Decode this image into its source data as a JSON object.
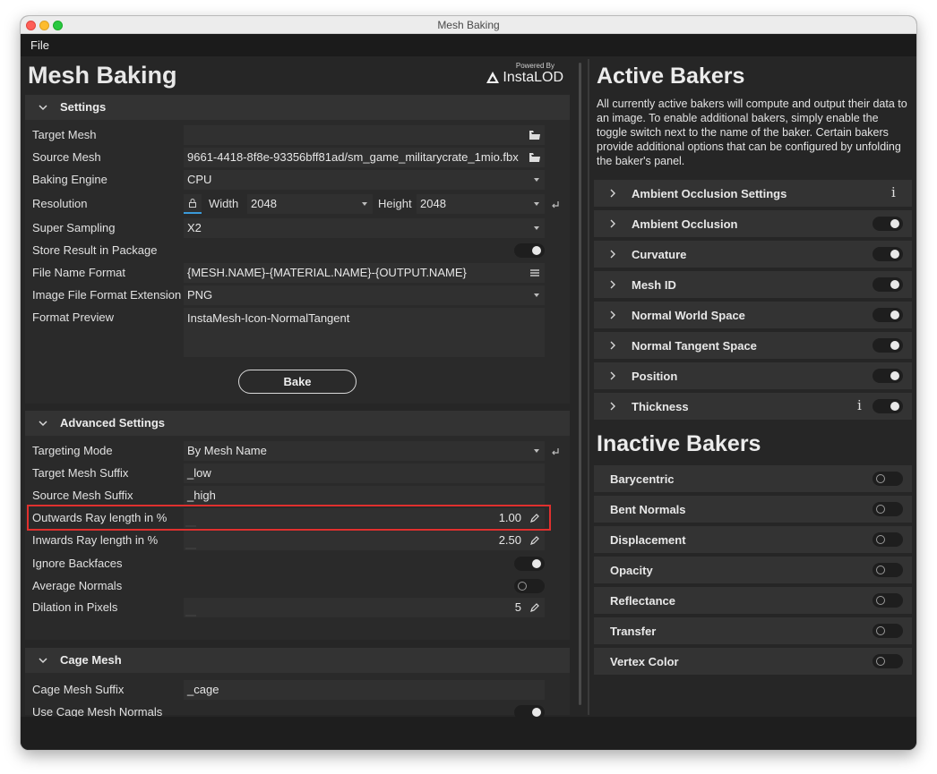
{
  "window": {
    "title": "Mesh Baking"
  },
  "menu": {
    "file": "File"
  },
  "app": {
    "title": "Mesh Baking",
    "powered_by": "Powered By",
    "brand": "InstaLOD"
  },
  "settings": {
    "header": "Settings",
    "target_mesh": {
      "label": "Target Mesh",
      "value": ""
    },
    "source_mesh": {
      "label": "Source Mesh",
      "value": "9661-4418-8f8e-93356bff81ad/sm_game_militarycrate_1mio.fbx"
    },
    "baking_engine": {
      "label": "Baking Engine",
      "value": "CPU"
    },
    "resolution": {
      "label": "Resolution",
      "width_label": "Width",
      "width": "2048",
      "height_label": "Height",
      "height": "2048"
    },
    "super_sampling": {
      "label": "Super Sampling",
      "value": "X2"
    },
    "store_result": {
      "label": "Store Result in Package",
      "on": true
    },
    "file_name_format": {
      "label": "File Name Format",
      "value": "{MESH.NAME}-{MATERIAL.NAME}-{OUTPUT.NAME}"
    },
    "image_ext": {
      "label": "Image File Format Extension",
      "value": "PNG"
    },
    "format_preview": {
      "label": "Format Preview",
      "value": "InstaMesh-Icon-NormalTangent"
    },
    "bake_button": "Bake"
  },
  "advanced": {
    "header": "Advanced Settings",
    "targeting_mode": {
      "label": "Targeting Mode",
      "value": "By Mesh Name"
    },
    "target_suffix": {
      "label": "Target Mesh Suffix",
      "value": "_low"
    },
    "source_suffix": {
      "label": "Source Mesh Suffix",
      "value": "_high"
    },
    "outwards_ray": {
      "label": "Outwards Ray length in %",
      "value": "1.00"
    },
    "inwards_ray": {
      "label": "Inwards Ray length in %",
      "value": "2.50"
    },
    "ignore_backfaces": {
      "label": "Ignore Backfaces",
      "on": true
    },
    "average_normals": {
      "label": "Average Normals",
      "on": false
    },
    "dilation": {
      "label": "Dilation in Pixels",
      "value": "5"
    }
  },
  "cage": {
    "header": "Cage Mesh",
    "suffix": {
      "label": "Cage Mesh Suffix",
      "value": "_cage"
    },
    "use_normals": {
      "label": "Use Cage Mesh Normals",
      "on": true
    }
  },
  "active": {
    "title": "Active Bakers",
    "description": "All currently active bakers will compute and output their data to an image. To enable additional bakers, simply enable the toggle switch next to the name of the baker. Certain bakers provide additional options that can be configured by unfolding the baker's panel.",
    "items": [
      {
        "name": "Ambient Occlusion Settings",
        "info": "i"
      },
      {
        "name": "Ambient Occlusion"
      },
      {
        "name": "Curvature"
      },
      {
        "name": "Mesh ID"
      },
      {
        "name": "Normal World Space"
      },
      {
        "name": "Normal Tangent Space"
      },
      {
        "name": "Position"
      },
      {
        "name": "Thickness",
        "info": "i"
      }
    ]
  },
  "inactive": {
    "title": "Inactive Bakers",
    "items": [
      {
        "name": "Barycentric"
      },
      {
        "name": "Bent Normals"
      },
      {
        "name": "Displacement"
      },
      {
        "name": "Opacity"
      },
      {
        "name": "Reflectance"
      },
      {
        "name": "Transfer"
      },
      {
        "name": "Vertex Color"
      }
    ]
  },
  "colors": {
    "highlight": "#e0302e",
    "background": "#262626",
    "panel": "#333333"
  }
}
